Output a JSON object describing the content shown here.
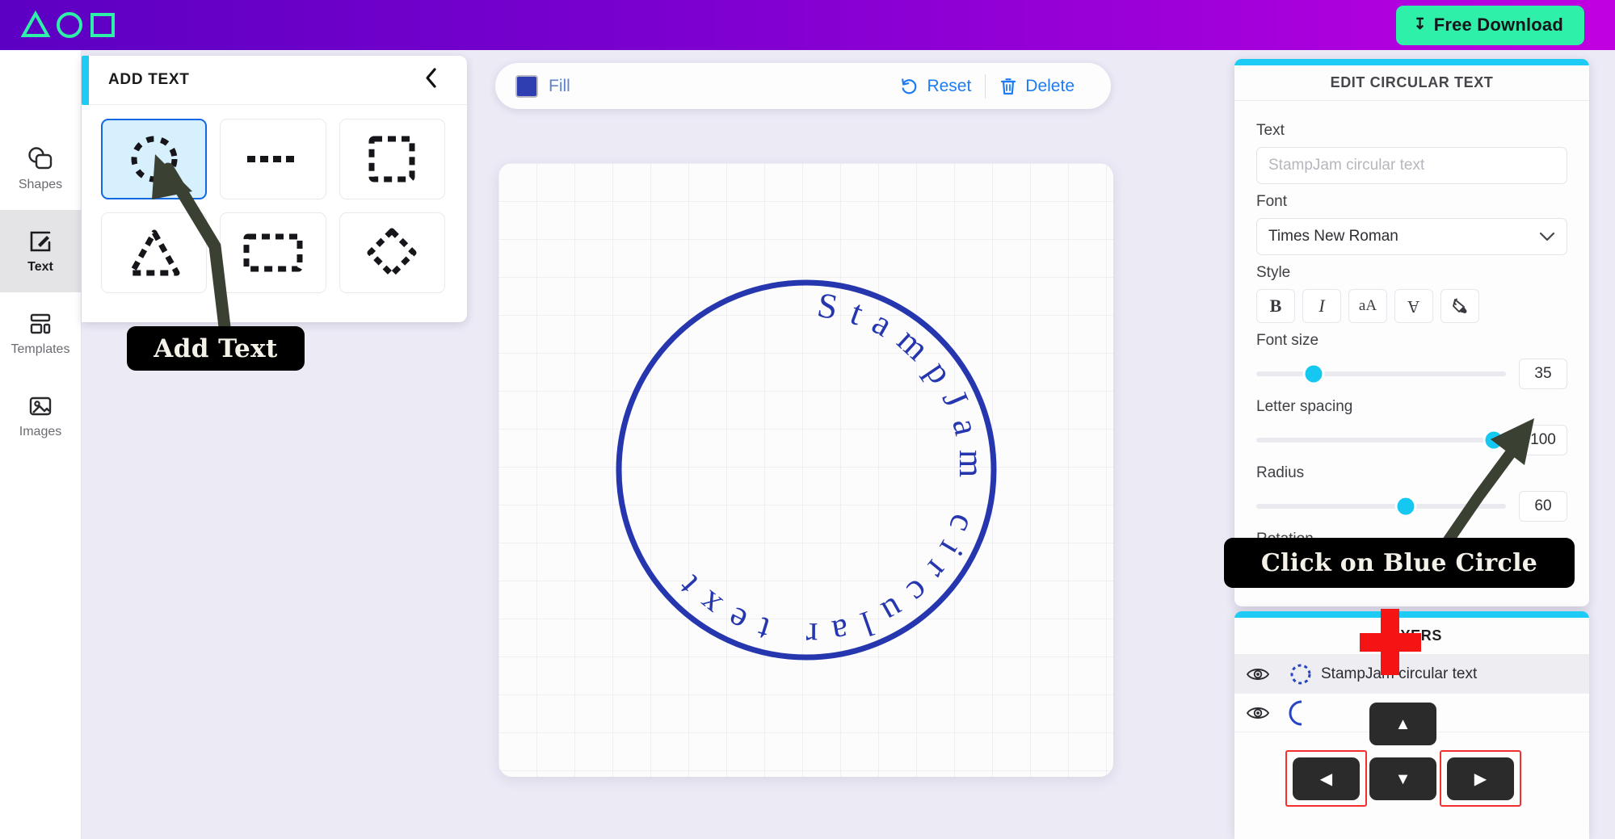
{
  "header": {
    "logo_name": "stampjam-logo",
    "download_label": "Free Download",
    "download_icon": "download-icon",
    "gradient_from": "#5c00c3",
    "gradient_to": "#c100e0",
    "accent_green": "#2ff0a8"
  },
  "rail": {
    "items": [
      {
        "label": "Shapes",
        "icon": "shapes-icon",
        "active": false
      },
      {
        "label": "Text",
        "icon": "text-edit-icon",
        "active": true
      },
      {
        "label": "Templates",
        "icon": "templates-icon",
        "active": false
      },
      {
        "label": "Images",
        "icon": "image-icon",
        "active": false
      }
    ]
  },
  "add_text_panel": {
    "title": "ADD TEXT",
    "collapse_icon": "chevron-left-icon",
    "accent_color": "#1ecbf5",
    "shapes": [
      {
        "name": "circle-path",
        "icon": "dashed-circle-icon",
        "selected": true
      },
      {
        "name": "line-path",
        "icon": "dashed-line-icon",
        "selected": false
      },
      {
        "name": "square-path",
        "icon": "dashed-square-icon",
        "selected": false
      },
      {
        "name": "triangle-path",
        "icon": "dashed-triangle-icon",
        "selected": false
      },
      {
        "name": "rectangle-path",
        "icon": "dashed-rectangle-icon",
        "selected": false
      },
      {
        "name": "diamond-path",
        "icon": "dashed-diamond-icon",
        "selected": false
      }
    ]
  },
  "callouts": {
    "add_text": "Add Text",
    "blue_circle": "Click on Blue Circle"
  },
  "toolbar": {
    "fill_label": "Fill",
    "fill_color": "#2f3fb1",
    "reset_label": "Reset",
    "reset_icon": "undo-icon",
    "delete_label": "Delete",
    "delete_icon": "trash-icon",
    "link_color": "#1d7cf2"
  },
  "canvas": {
    "stamp_text": "StampJam circular text",
    "stamp_color": "#2536ae",
    "ring_stroke_width": 7,
    "grid": true
  },
  "edit_panel": {
    "title": "EDIT CIRCULAR TEXT",
    "accent_color": "#1ecbf5",
    "text": {
      "label": "Text",
      "value": "",
      "placeholder": "StampJam circular text"
    },
    "font": {
      "label": "Font",
      "value": "Times New Roman",
      "caret_icon": "chevron-down-icon"
    },
    "style": {
      "label": "Style",
      "buttons": [
        {
          "name": "bold-button",
          "glyph": "B"
        },
        {
          "name": "italic-button",
          "glyph": "I"
        },
        {
          "name": "text-case-button",
          "glyph": "aA"
        },
        {
          "name": "flip-button",
          "glyph": "A"
        },
        {
          "name": "fill-color-button",
          "glyph": "paint-bucket-icon"
        }
      ]
    },
    "sliders": [
      {
        "label": "Font size",
        "value": "35",
        "percent": 23
      },
      {
        "label": "Letter spacing",
        "value": "100",
        "percent": 95
      },
      {
        "label": "Radius",
        "value": "60",
        "percent": 60
      }
    ],
    "rotation_label": "Rotation"
  },
  "layers_panel": {
    "title": "LAYERS",
    "rows": [
      {
        "name": "StampJam circular text",
        "icon": "dashed-circle-icon",
        "visible": true,
        "selected": true
      },
      {
        "name": "",
        "icon": "arc-icon",
        "visible": true,
        "selected": false
      }
    ],
    "eye_icon": "eye-icon"
  },
  "keypad": {
    "up": {
      "name": "nudge-up-button",
      "glyph": "▲",
      "highlighted": false
    },
    "left": {
      "name": "nudge-left-button",
      "glyph": "◀",
      "highlighted": true
    },
    "down": {
      "name": "nudge-down-button",
      "glyph": "▼",
      "highlighted": false
    },
    "right": {
      "name": "nudge-right-button",
      "glyph": "▶",
      "highlighted": true
    },
    "highlight_color": "#f23030"
  },
  "annotations": {
    "red_plus_color": "#f41414",
    "arrow_color": "#3a4132"
  }
}
